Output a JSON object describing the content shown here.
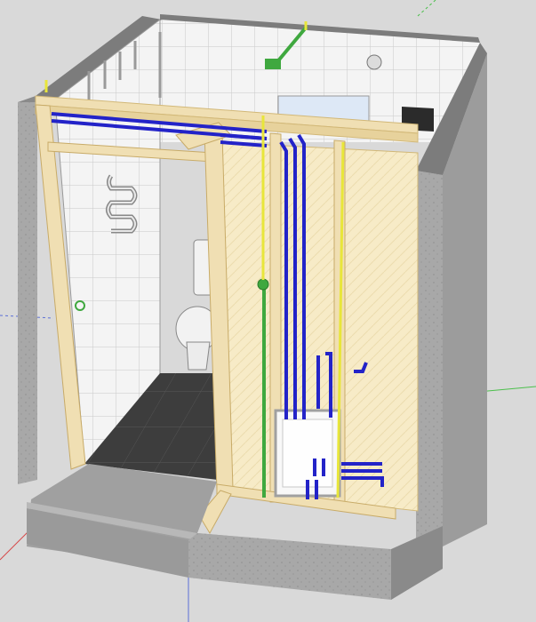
{
  "scene": {
    "subject": "bathroom-cutaway-3d-model",
    "colors": {
      "background": "#d9d9d9",
      "concrete": "#a8a8a8",
      "concrete_dark": "#7c7c7c",
      "concrete_top": "#bdbdbd",
      "tile": "#f4f4f4",
      "tile_grid": "#c9c9c9",
      "floor": "#3d3d3d",
      "wood": "#f0dfb3",
      "wood_edge": "#d2b878",
      "drywall": "#f7ebc7",
      "blue_pipe": "#2323c8",
      "green_pipe": "#3fa83f",
      "yellow_pipe": "#e8e63a",
      "toilet": "#f2f2f2",
      "axis_green": "#4bbf4b",
      "axis_red": "#d64a4a",
      "axis_blue": "#5b6fd6"
    },
    "objects": [
      "concrete-walls",
      "tiled-walls",
      "floor-tiles",
      "wood-stud-frame",
      "drywall-panel",
      "water-pipes",
      "gas-pipe",
      "electrical-conduit",
      "toilet",
      "heated-towel-rail",
      "access-hatch",
      "ceiling-light",
      "wall-mirror",
      "corner-cabinet"
    ]
  }
}
